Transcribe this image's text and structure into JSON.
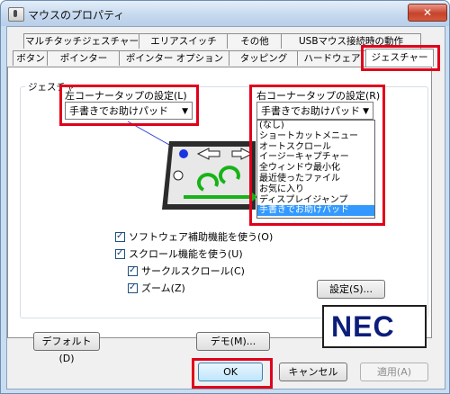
{
  "window": {
    "title": "マウスのプロパティ",
    "close_glyph": "✕"
  },
  "tabs_row1": [
    {
      "label": "マルチタッチジェスチャー"
    },
    {
      "label": "エリアスイッチ"
    },
    {
      "label": "その他"
    },
    {
      "label": "USBマウス接続時の動作"
    }
  ],
  "tabs_row2": [
    {
      "label": "ボタン"
    },
    {
      "label": "ポインター"
    },
    {
      "label": "ポインター オプション"
    },
    {
      "label": "タッピング"
    },
    {
      "label": "ハードウェア"
    },
    {
      "label": "ジェスチャー"
    }
  ],
  "gesture": {
    "group_label": "ジェスチャー",
    "left_corner_label": "左コーナータップの設定(L)",
    "left_corner_value": "手書きでお助けパッド",
    "right_corner_label": "右コーナータップの設定(R)",
    "right_corner_value": "手書きでお助けパッド",
    "dropdown_arrow": "▼",
    "right_options": [
      "(なし)",
      "ショートカットメニュー",
      "オートスクロール",
      "イージーキャプチャー",
      "全ウィンドウ最小化",
      "最近使ったファイル",
      "お気に入り",
      "ディスプレイジャンプ",
      "手書きでお助けパッド"
    ],
    "selected_index": 8
  },
  "options": {
    "software_assist": "ソフトウェア補助機能を使う(O)",
    "scroll": "スクロール機能を使う(U)",
    "circle_scroll": "サークルスクロール(C)",
    "zoom": "ズーム(Z)",
    "settings_button": "設定(S)..."
  },
  "buttons": {
    "default": "デフォルト(D)",
    "demo": "デモ(M)...",
    "ok": "OK",
    "cancel": "キャンセル",
    "apply": "適用(A)"
  },
  "logo": {
    "text": "NEC"
  },
  "colors": {
    "highlight": "#e0001b",
    "selection": "#3399ff",
    "logo": "#0c1d7a",
    "gesture_green": "#17b317"
  }
}
